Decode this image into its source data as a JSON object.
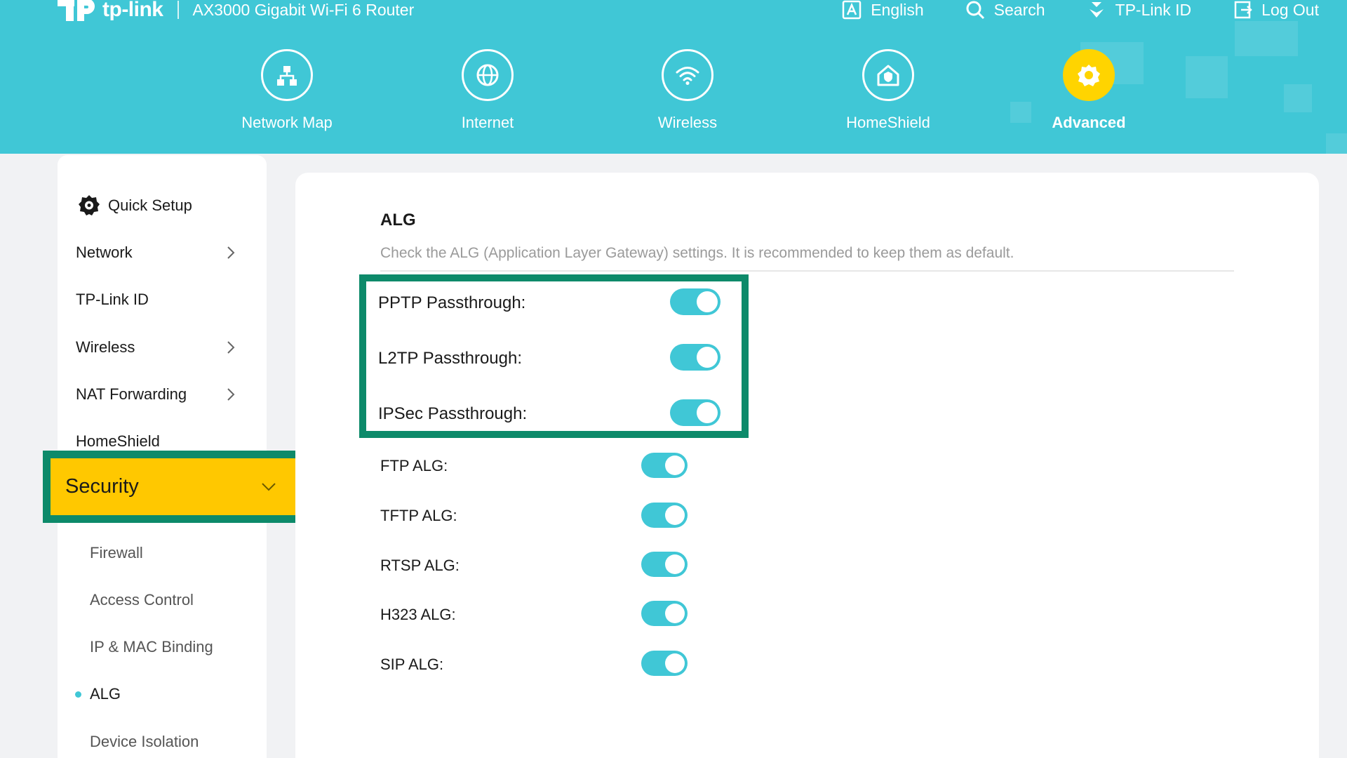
{
  "colors": {
    "header_bg": "#40c7d6",
    "accent": "#40c7d6",
    "active_tab": "#ffd400",
    "highlight_yellow": "#ffc800",
    "annotation_green": "#0d8a6a"
  },
  "brand": {
    "logo_text": "tp-link",
    "model": "AX3000 Gigabit Wi-Fi 6 Router"
  },
  "topnav": {
    "language": "English",
    "search": "Search",
    "tplink_id": "TP-Link ID",
    "logout": "Log Out"
  },
  "mainnav": {
    "items": [
      {
        "label": "Network Map",
        "icon": "network-map-icon"
      },
      {
        "label": "Internet",
        "icon": "globe-icon"
      },
      {
        "label": "Wireless",
        "icon": "wifi-icon"
      },
      {
        "label": "HomeShield",
        "icon": "home-shield-icon"
      },
      {
        "label": "Advanced",
        "icon": "gear-icon",
        "active": true
      }
    ]
  },
  "sidebar": {
    "items": [
      {
        "label": "Quick Setup",
        "icon": "quick-setup-gear-icon"
      },
      {
        "label": "Network",
        "expandable": true
      },
      {
        "label": "TP-Link ID"
      },
      {
        "label": "Wireless",
        "expandable": true
      },
      {
        "label": "NAT Forwarding",
        "expandable": true
      },
      {
        "label": "HomeShield"
      },
      {
        "label": "Security",
        "expanded": true
      }
    ],
    "security_sub": [
      {
        "label": "Firewall"
      },
      {
        "label": "Access Control"
      },
      {
        "label": "IP & MAC Binding"
      },
      {
        "label": "ALG",
        "current": true
      },
      {
        "label": "Device Isolation"
      }
    ]
  },
  "alg": {
    "title": "ALG",
    "description": "Check the ALG (Application Layer Gateway) settings. It is recommended to keep them as default.",
    "highlighted_settings": [
      {
        "label": "PPTP Passthrough:",
        "enabled": true
      },
      {
        "label": "L2TP Passthrough:",
        "enabled": true
      },
      {
        "label": "IPSec Passthrough:",
        "enabled": true
      }
    ],
    "settings": [
      {
        "label": "FTP ALG:",
        "enabled": true
      },
      {
        "label": "TFTP ALG:",
        "enabled": true
      },
      {
        "label": "RTSP ALG:",
        "enabled": true
      },
      {
        "label": "H323 ALG:",
        "enabled": true
      },
      {
        "label": "SIP ALG:",
        "enabled": true
      }
    ]
  }
}
